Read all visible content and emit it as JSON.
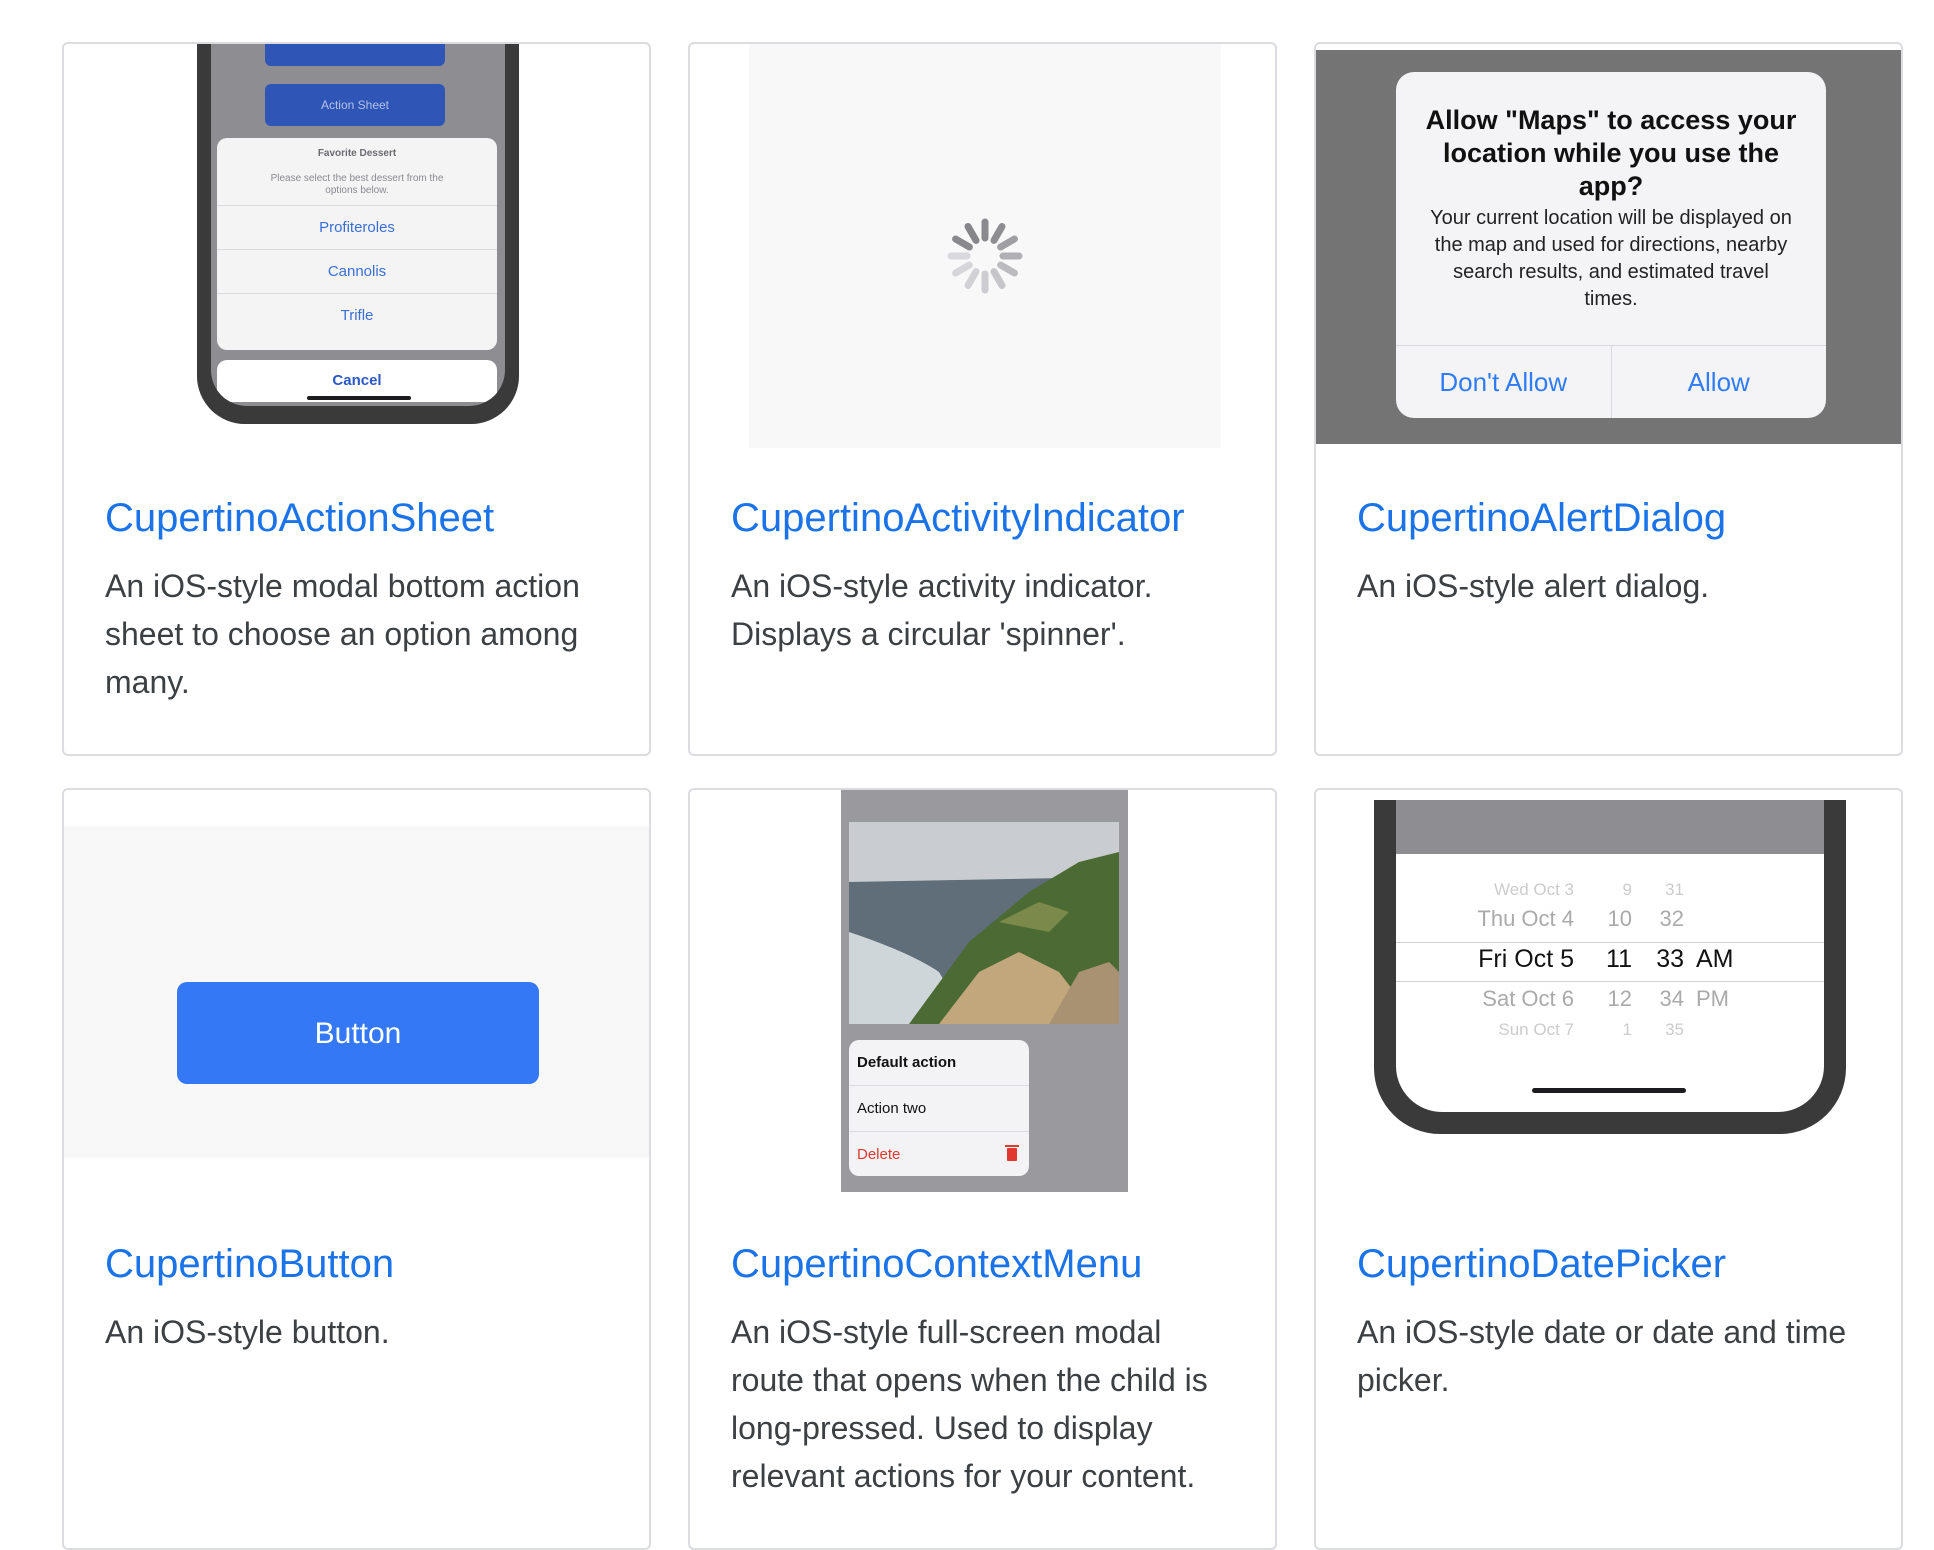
{
  "cards": [
    {
      "title": "CupertinoActionSheet",
      "description": "An iOS-style modal bottom action sheet to choose an option among many.",
      "preview": {
        "ghost_button": "Action Sheet",
        "sheet_title": "Favorite Dessert",
        "sheet_message": "Please select the best dessert from the options below.",
        "options": [
          "Profiteroles",
          "Cannolis",
          "Trifle"
        ],
        "cancel": "Cancel"
      }
    },
    {
      "title": "CupertinoActivityIndicator",
      "description": "An iOS-style activity indicator. Displays a circular 'spinner'."
    },
    {
      "title": "CupertinoAlertDialog",
      "description": "An iOS-style alert dialog.",
      "preview": {
        "alert_title": "Allow \"Maps\" to access your location while you use the app?",
        "alert_message": "Your current location will be displayed on the map and used for directions, nearby search results, and estimated travel times.",
        "dont_allow": "Don't Allow",
        "allow": "Allow"
      }
    },
    {
      "title": "CupertinoButton",
      "description": "An iOS-style button.",
      "preview": {
        "button_label": "Button"
      }
    },
    {
      "title": "CupertinoContextMenu",
      "description": "An iOS-style full-screen modal route that opens when the child is long-pressed. Used to display relevant actions for your content.",
      "preview": {
        "actions": [
          "Default action",
          "Action two",
          "Delete"
        ]
      }
    },
    {
      "title": "CupertinoDatePicker",
      "description": "An iOS-style date or date and time picker.",
      "preview": {
        "rows": [
          {
            "date": "Wed Oct 3",
            "hour": "9",
            "minute": "31",
            "ampm": ""
          },
          {
            "date": "Thu Oct 4",
            "hour": "10",
            "minute": "32",
            "ampm": ""
          },
          {
            "date": "Fri Oct 5",
            "hour": "11",
            "minute": "33",
            "ampm": "AM"
          },
          {
            "date": "Sat Oct 6",
            "hour": "12",
            "minute": "34",
            "ampm": "PM"
          },
          {
            "date": "Sun Oct 7",
            "hour": "1",
            "minute": "35",
            "ampm": ""
          }
        ]
      }
    }
  ],
  "colors": {
    "link": "#1a73e8",
    "ios_blue": "#3478f6",
    "destructive": "#e0382f"
  }
}
